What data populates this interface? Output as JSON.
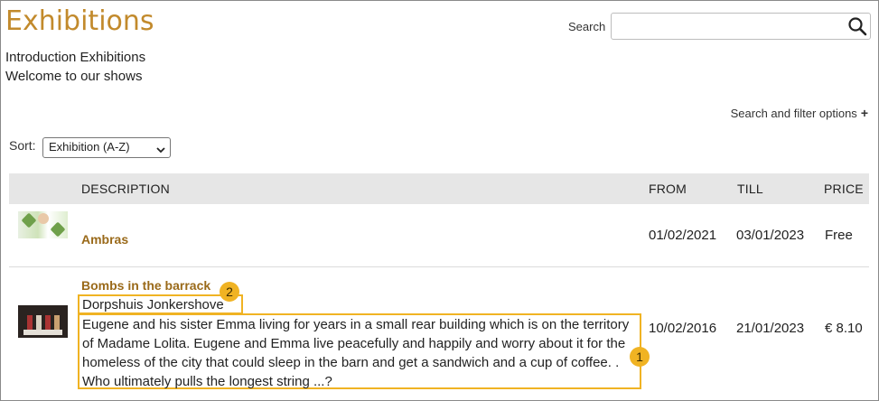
{
  "page": {
    "title": "Exhibitions",
    "intro_line1": "Introduction Exhibitions",
    "intro_line2": "Welcome to our shows"
  },
  "search": {
    "label": "Search",
    "value": "",
    "placeholder": "",
    "icon": "search-icon"
  },
  "filter": {
    "label": "Search and filter options",
    "icon_text": "+"
  },
  "sort": {
    "label": "Sort:",
    "selected": "Exhibition (A-Z)"
  },
  "table": {
    "columns": [
      "DESCRIPTION",
      "FROM",
      "TILL",
      "PRICE"
    ],
    "rows": [
      {
        "title": "Ambras",
        "subtitle": "",
        "description": "",
        "from": "01/02/2021",
        "till": "03/01/2023",
        "price": "Free"
      },
      {
        "title": "Bombs in the barrack",
        "subtitle": "Dorpshuis Jonkershove",
        "description": "Eugene and his sister Emma living for years in a small rear building which is on the territory of Madame Lolita. Eugene and Emma live peacefully and happily and worry about it for the homeless of the city that could sleep in the barn and get a sandwich and a cup of coffee. . Who ultimately pulls the longest string ...?",
        "from": "10/02/2016",
        "till": "21/01/2023",
        "price": "€ 8.10"
      }
    ]
  },
  "annotations": [
    {
      "number": "1"
    },
    {
      "number": "2"
    }
  ],
  "colors": {
    "accent": "#c28a2c",
    "link": "#9a6a1a",
    "highlight": "#f0b323",
    "header_bg": "#e6e6e6"
  }
}
